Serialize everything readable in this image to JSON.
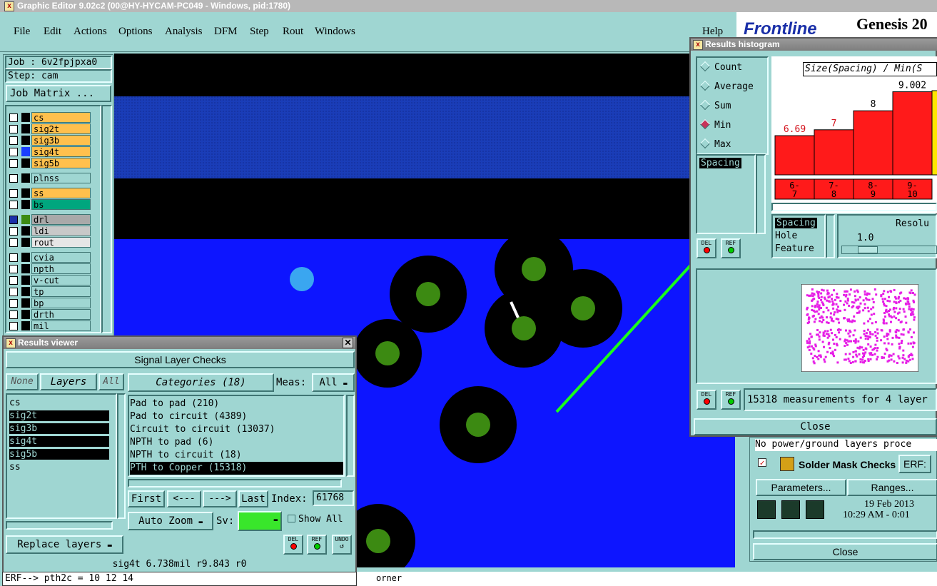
{
  "app": {
    "title": "Graphic Editor 9.02c2 (00@HY-HYCAM-PC049 - Windows, pid:1780)",
    "menu": [
      "File",
      "Edit",
      "Actions",
      "Options",
      "Analysis",
      "DFM",
      "Step",
      "Rout",
      "Windows"
    ],
    "help": "Help",
    "brand": "Frontline",
    "product": "Genesis 20"
  },
  "job": {
    "job_label": "Job : 6v2fpjpxa0",
    "step_label": "Step: cam",
    "matrix_button": "Job Matrix ..."
  },
  "layers": [
    {
      "name": "cs",
      "color": "#ffc04d"
    },
    {
      "name": "sig2t",
      "color": "#ffc04d"
    },
    {
      "name": "sig3b",
      "color": "#ffc04d"
    },
    {
      "name": "sig4t",
      "color": "#ffc04d"
    },
    {
      "name": "sig5b",
      "color": "#ffc04d"
    },
    {
      "name": "plnss",
      "color": "#9fd6d2"
    },
    {
      "name": "ss",
      "color": "#ffc04d"
    },
    {
      "name": "bs",
      "color": "#00a67e"
    },
    {
      "name": "drl",
      "color": "#a9a9a9"
    },
    {
      "name": "ldi",
      "color": "#c8c8c8"
    },
    {
      "name": "rout",
      "color": "#e6e6e6"
    },
    {
      "name": "cvia",
      "color": "#9fd6d2"
    },
    {
      "name": "npth",
      "color": "#9fd6d2"
    },
    {
      "name": "v-cut",
      "color": "#9fd6d2"
    },
    {
      "name": "tp",
      "color": "#9fd6d2"
    },
    {
      "name": "bp",
      "color": "#9fd6d2"
    },
    {
      "name": "drth",
      "color": "#9fd6d2"
    },
    {
      "name": "mil",
      "color": "#9fd6d2"
    }
  ],
  "results_viewer": {
    "title": "Results viewer",
    "heading": "Signal Layer Checks",
    "none_btn": "None",
    "layers_btn": "Layers",
    "all_btn": "All",
    "layer_list": [
      "cs",
      "sig2t",
      "sig3b",
      "sig4t",
      "sig5b",
      "ss"
    ],
    "categories_btn": "Categories (18)",
    "meas_label": "Meas:",
    "meas_value": "All",
    "categories": [
      "Pad to pad (210)",
      "Pad to circuit (4389)",
      "Circuit to circuit (13037)",
      "NPTH to pad (6)",
      "NPTH to circuit (18)",
      "PTH to Copper (15318)"
    ],
    "first": "First",
    "prev": "<---",
    "next": "--->",
    "last": "Last",
    "index_label": "Index:",
    "index_value": "61768",
    "auto_zoom": "Auto Zoom",
    "sv_label": "Sv:",
    "show_all": "Show All",
    "replace_layers": "Replace layers",
    "status": "sig4t  6.738mil  r9.843  r0",
    "del": "DEL",
    "ref": "REF",
    "undo": "UNDO"
  },
  "command_line": "ERF--> pth2c = 10 12 14",
  "status_tail": "orner",
  "histogram": {
    "title": "Results histogram",
    "options": [
      "Count",
      "Average",
      "Sum",
      "Min",
      "Max"
    ],
    "selected": "Min",
    "chart_title": "Size(Spacing) / Min(S",
    "list_top": "Spacing",
    "list_bottom": [
      "Spacing",
      "Hole",
      "Feature"
    ],
    "resolution_label": "Resolu",
    "resolution_value": "1.0",
    "summary": "15318 measurements for 4 layer",
    "close": "Close",
    "del": "DEL",
    "ref": "REF"
  },
  "chart_data": {
    "type": "bar",
    "title": "Size(Spacing) / Min(S",
    "categories": [
      "6-7",
      "7-8",
      "8-9",
      "9-10"
    ],
    "values": [
      6.69,
      7,
      8,
      9.002
    ],
    "value_labels": [
      "6.69",
      "7",
      "8",
      "9.002"
    ],
    "colors": [
      "#ff1a1a",
      "#ff1a1a",
      "#ff1a1a",
      "#ff1a1a"
    ]
  },
  "solder_mask": {
    "no_power": "No power/ground layers proce",
    "title": "Solder Mask Checks",
    "erf": "ERF:",
    "parameters": "Parameters...",
    "ranges": "Ranges...",
    "date": "19 Feb 2013",
    "time": "10:29 AM - 0:01",
    "close": "Close"
  }
}
